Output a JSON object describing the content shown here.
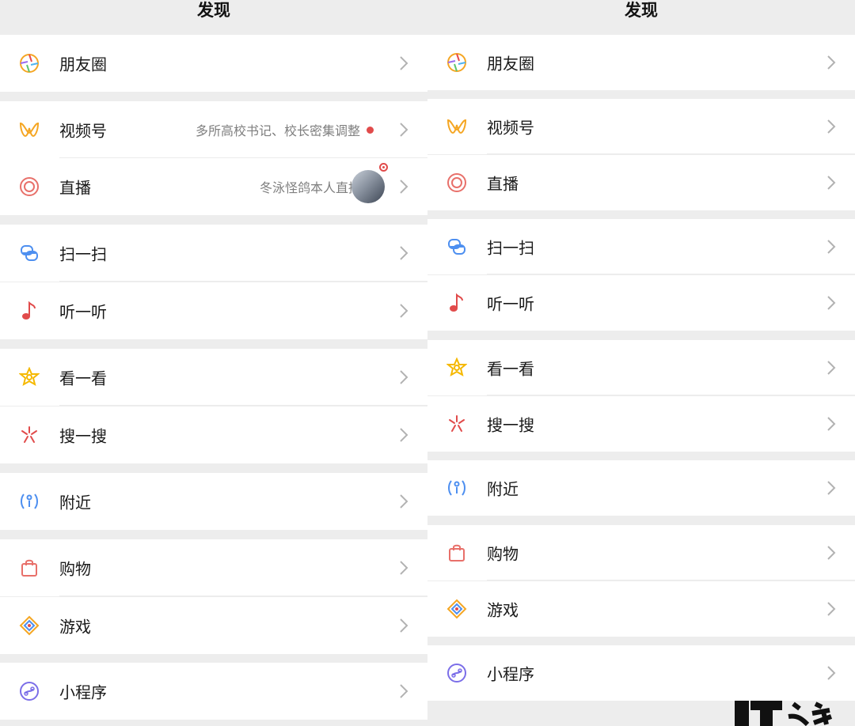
{
  "left": {
    "title": "发现",
    "items": [
      {
        "key": "moments",
        "label": "朋友圈"
      },
      {
        "key": "channels",
        "label": "视频号",
        "subtitle": "多所高校书记、校长密集调整"
      },
      {
        "key": "live",
        "label": "直播",
        "subtitle": "冬泳怪鸽本人直播中"
      },
      {
        "key": "scan",
        "label": "扫一扫"
      },
      {
        "key": "shake",
        "label": "听一听"
      },
      {
        "key": "top-stories",
        "label": "看一看"
      },
      {
        "key": "search",
        "label": "搜一搜"
      },
      {
        "key": "nearby",
        "label": "附近"
      },
      {
        "key": "shopping",
        "label": "购物"
      },
      {
        "key": "games",
        "label": "游戏"
      },
      {
        "key": "mini-programs",
        "label": "小程序"
      }
    ]
  },
  "right": {
    "title": "发现",
    "items": [
      {
        "key": "moments",
        "label": "朋友圈"
      },
      {
        "key": "channels",
        "label": "视频号"
      },
      {
        "key": "live",
        "label": "直播"
      },
      {
        "key": "scan",
        "label": "扫一扫"
      },
      {
        "key": "shake",
        "label": "听一听"
      },
      {
        "key": "top-stories",
        "label": "看一看"
      },
      {
        "key": "search",
        "label": "搜一搜"
      },
      {
        "key": "nearby",
        "label": "附近"
      },
      {
        "key": "shopping",
        "label": "购物"
      },
      {
        "key": "games",
        "label": "游戏"
      },
      {
        "key": "mini-programs",
        "label": "小程序"
      }
    ]
  },
  "watermark": {
    "text": "IT之家"
  },
  "colors": {
    "background": "#ededed",
    "row": "#ffffff",
    "red_dot": "#e14b4b",
    "chevron": "#b2b2b2"
  }
}
